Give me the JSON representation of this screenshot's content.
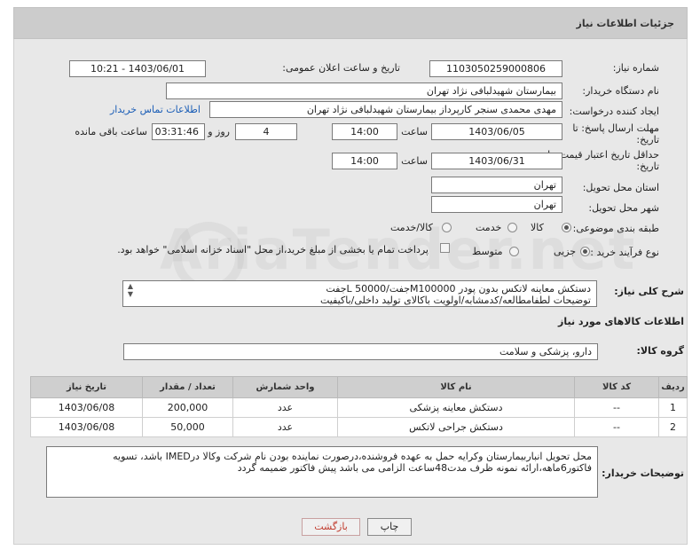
{
  "header": {
    "title": "جزئیات اطلاعات نیاز"
  },
  "form": {
    "need_number_label": "شماره نیاز:",
    "need_number": "1103050259000806",
    "announce_label": "تاریخ و ساعت اعلان عمومی:",
    "announce_value": "1403/06/01 - 10:21",
    "buyer_org_label": "نام دستگاه خریدار:",
    "buyer_org": "بیمارستان شهیدلبافی نژاد تهران",
    "creator_label": "ایجاد کننده درخواست:",
    "creator": "مهدی محمدی سنجر کارپرداز بیمارستان شهیدلبافی نژاد تهران",
    "contact_link": "اطلاعات تماس خریدار",
    "deadline_label_1": "مهلت ارسال پاسخ: تا",
    "deadline_label_2": "تاریخ:",
    "deadline_date": "1403/06/05",
    "time_label": "ساعت",
    "deadline_time": "14:00",
    "days_value": "4",
    "days_label": "روز و",
    "remaining_time": "03:31:46",
    "remaining_label": "ساعت باقی مانده",
    "validity_label_1": "حداقل تاریخ اعتبار قیمت: تا",
    "validity_label_2": "تاریخ:",
    "validity_date": "1403/06/31",
    "validity_time": "14:00",
    "province_label": "استان محل تحویل:",
    "province": "تهران",
    "city_label": "شهر محل تحویل:",
    "city": "تهران",
    "category_label": "طبقه بندی موضوعی:",
    "category_options": [
      "کالا",
      "خدمت",
      "کالا/خدمت"
    ],
    "category_selected": 0,
    "process_label": "نوع فرآیند خرید :",
    "process_options": [
      "جزیی",
      "متوسط"
    ],
    "process_selected": 0,
    "payment_note": "پرداخت تمام یا بخشی از مبلغ خرید،از محل \"اسناد خزانه اسلامی\" خواهد بود."
  },
  "summary": {
    "label": "شرح کلی نیاز:",
    "line1": "دستکش معاینه لاتکس بدون پودر M100000جفت/50000 Lجفت",
    "line2": "توضیحات لطفامطالعه/کدمشابه/اولویت باکالای تولید داخلی/باکیفیت"
  },
  "goods_info_title": "اطلاعات کالاهای مورد نیاز",
  "goods_group": {
    "label": "گروه کالا:",
    "value": "دارو، پزشکی و سلامت"
  },
  "table": {
    "headers": [
      "ردیف",
      "کد کالا",
      "نام کالا",
      "واحد شمارش",
      "تعداد / مقدار",
      "تاریخ نیاز"
    ],
    "rows": [
      {
        "row": "1",
        "code": "--",
        "name": "دستکش معاینه پزشکی",
        "unit": "عدد",
        "qty": "200,000",
        "date": "1403/06/08"
      },
      {
        "row": "2",
        "code": "--",
        "name": "دستکش جراحی لاتکس",
        "unit": "عدد",
        "qty": "50,000",
        "date": "1403/06/08"
      }
    ]
  },
  "buyer_notes": {
    "label": "توضیحات خریدار:",
    "text": "محل تحویل انباربیمارستان وکرایه حمل به عهده فروشنده،درصورت نماینده بودن نام شرکت وکالا درIMED باشد، تسویه فاکتور6ماهه،ارائه نمونه ظرف مدت48ساعت الزامی می باشد پیش فاکتور ضمیمه گردد"
  },
  "buttons": {
    "print": "چاپ",
    "back": "بازگشت"
  },
  "watermark": "AriaTender.net",
  "colors": {
    "header_bg": "#cccccc",
    "panel_bg": "#e8e8e8",
    "link": "#1a5db6"
  }
}
